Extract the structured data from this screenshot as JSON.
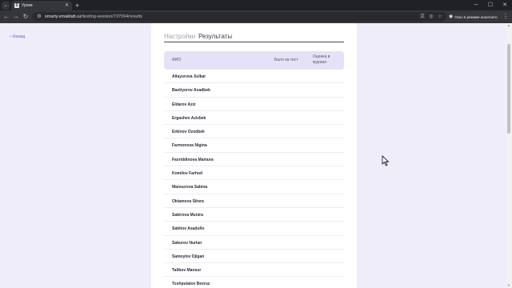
{
  "browser": {
    "tab_title": "Уроки",
    "favicon_letter": "S",
    "url_host": "smarty.emaktab.uz",
    "url_path": "/testing-session/737594/results",
    "incognito_label": "Окно в режиме инкогнито"
  },
  "page": {
    "back_label": "‹ Назад",
    "tabs": {
      "settings": "Настройки",
      "results": "Результаты"
    },
    "table": {
      "col_name": "ФИО",
      "col_score": "Балл за тест",
      "col_grade": "Оценка в журнал"
    },
    "students": [
      "Allayorova Xulkar",
      "Baxtiyorov Asadbek",
      "Eldarov Aziz",
      "Ergashev Azizbek",
      "Erkinov Ozodbek",
      "Farmonova Nigina",
      "Faxriddinova Mamura",
      "Komilov Farhod",
      "Mansurova Sabina",
      "Oktamova Sitora",
      "Sabirova Munira",
      "Sabitov Asadullo",
      "Saburov Nurlan",
      "Samoylov Djigan",
      "Talibov Mansur",
      "Toshpulatov Bexruz"
    ]
  },
  "colors": {
    "accent": "#6a5fd0",
    "page_bg": "#efedf9",
    "header_bg": "#e4e1f8"
  }
}
